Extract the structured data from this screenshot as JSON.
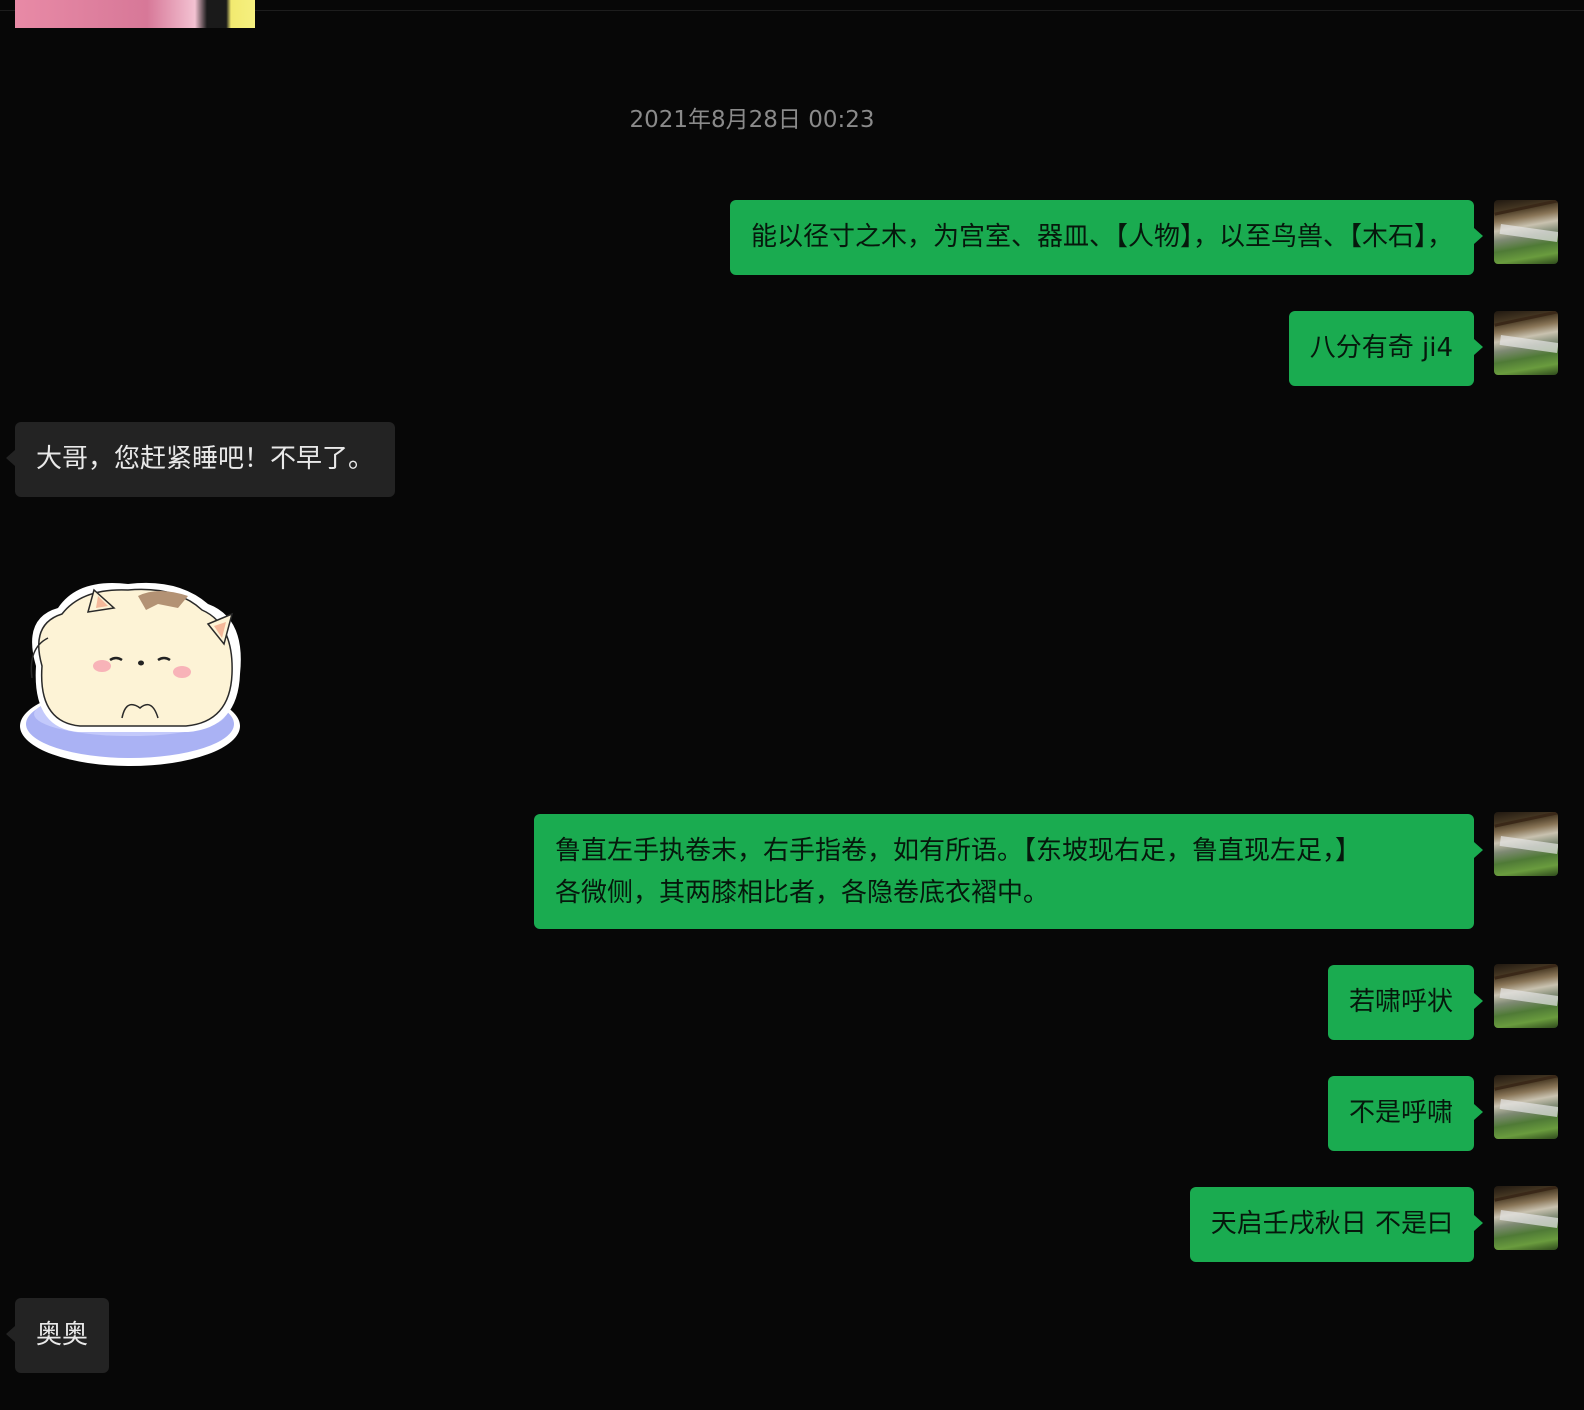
{
  "timestamp": "2021年8月28日 00:23",
  "messages": [
    {
      "text": "能以径寸之木，为宫室、器皿、【人物】，以至鸟兽、【木石】，"
    },
    {
      "text": "八分有奇 ji4"
    },
    {
      "text": "大哥，您赶紧睡吧！不早了。"
    },
    {
      "line1": "鲁直左手执卷末，右手指卷，如有所语。【东坡现右足，鲁直现左足，】",
      "line2": "各微侧，其两膝相比者，各隐卷底衣褶中。"
    },
    {
      "text": "若啸呼状"
    },
    {
      "text": "不是呼啸"
    },
    {
      "text": "天启壬戌秋日 不是曰"
    },
    {
      "text": "奥奥"
    }
  ]
}
